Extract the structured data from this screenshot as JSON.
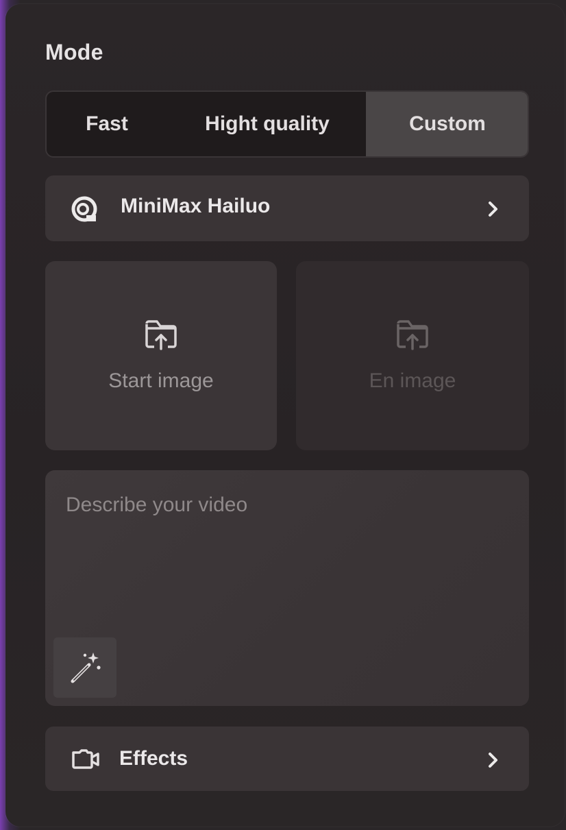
{
  "mode": {
    "title": "Mode",
    "options": [
      {
        "label": "Fast",
        "selected": false
      },
      {
        "label": "Hight quality",
        "selected": false
      },
      {
        "label": "Custom",
        "selected": true
      }
    ]
  },
  "model": {
    "label": "MiniMax Hailuo",
    "icon": "minimax-logo-icon",
    "chevron_icon": "chevron-right-icon"
  },
  "uploads": {
    "start": {
      "label": "Start image",
      "icon": "folder-upload-icon"
    },
    "end": {
      "label": "En image",
      "icon": "folder-upload-icon"
    }
  },
  "prompt": {
    "placeholder": "Describe your video",
    "value": "",
    "enhance_icon": "magic-wand-icon"
  },
  "effects": {
    "label": "Effects",
    "icon": "video-camera-icon",
    "chevron_icon": "chevron-right-icon"
  },
  "colors": {
    "panel_bg": "#2b2628",
    "selected_segment": "#4a4647",
    "row_bg": "#3a3436",
    "accent_edge": "#7a3fb0"
  }
}
